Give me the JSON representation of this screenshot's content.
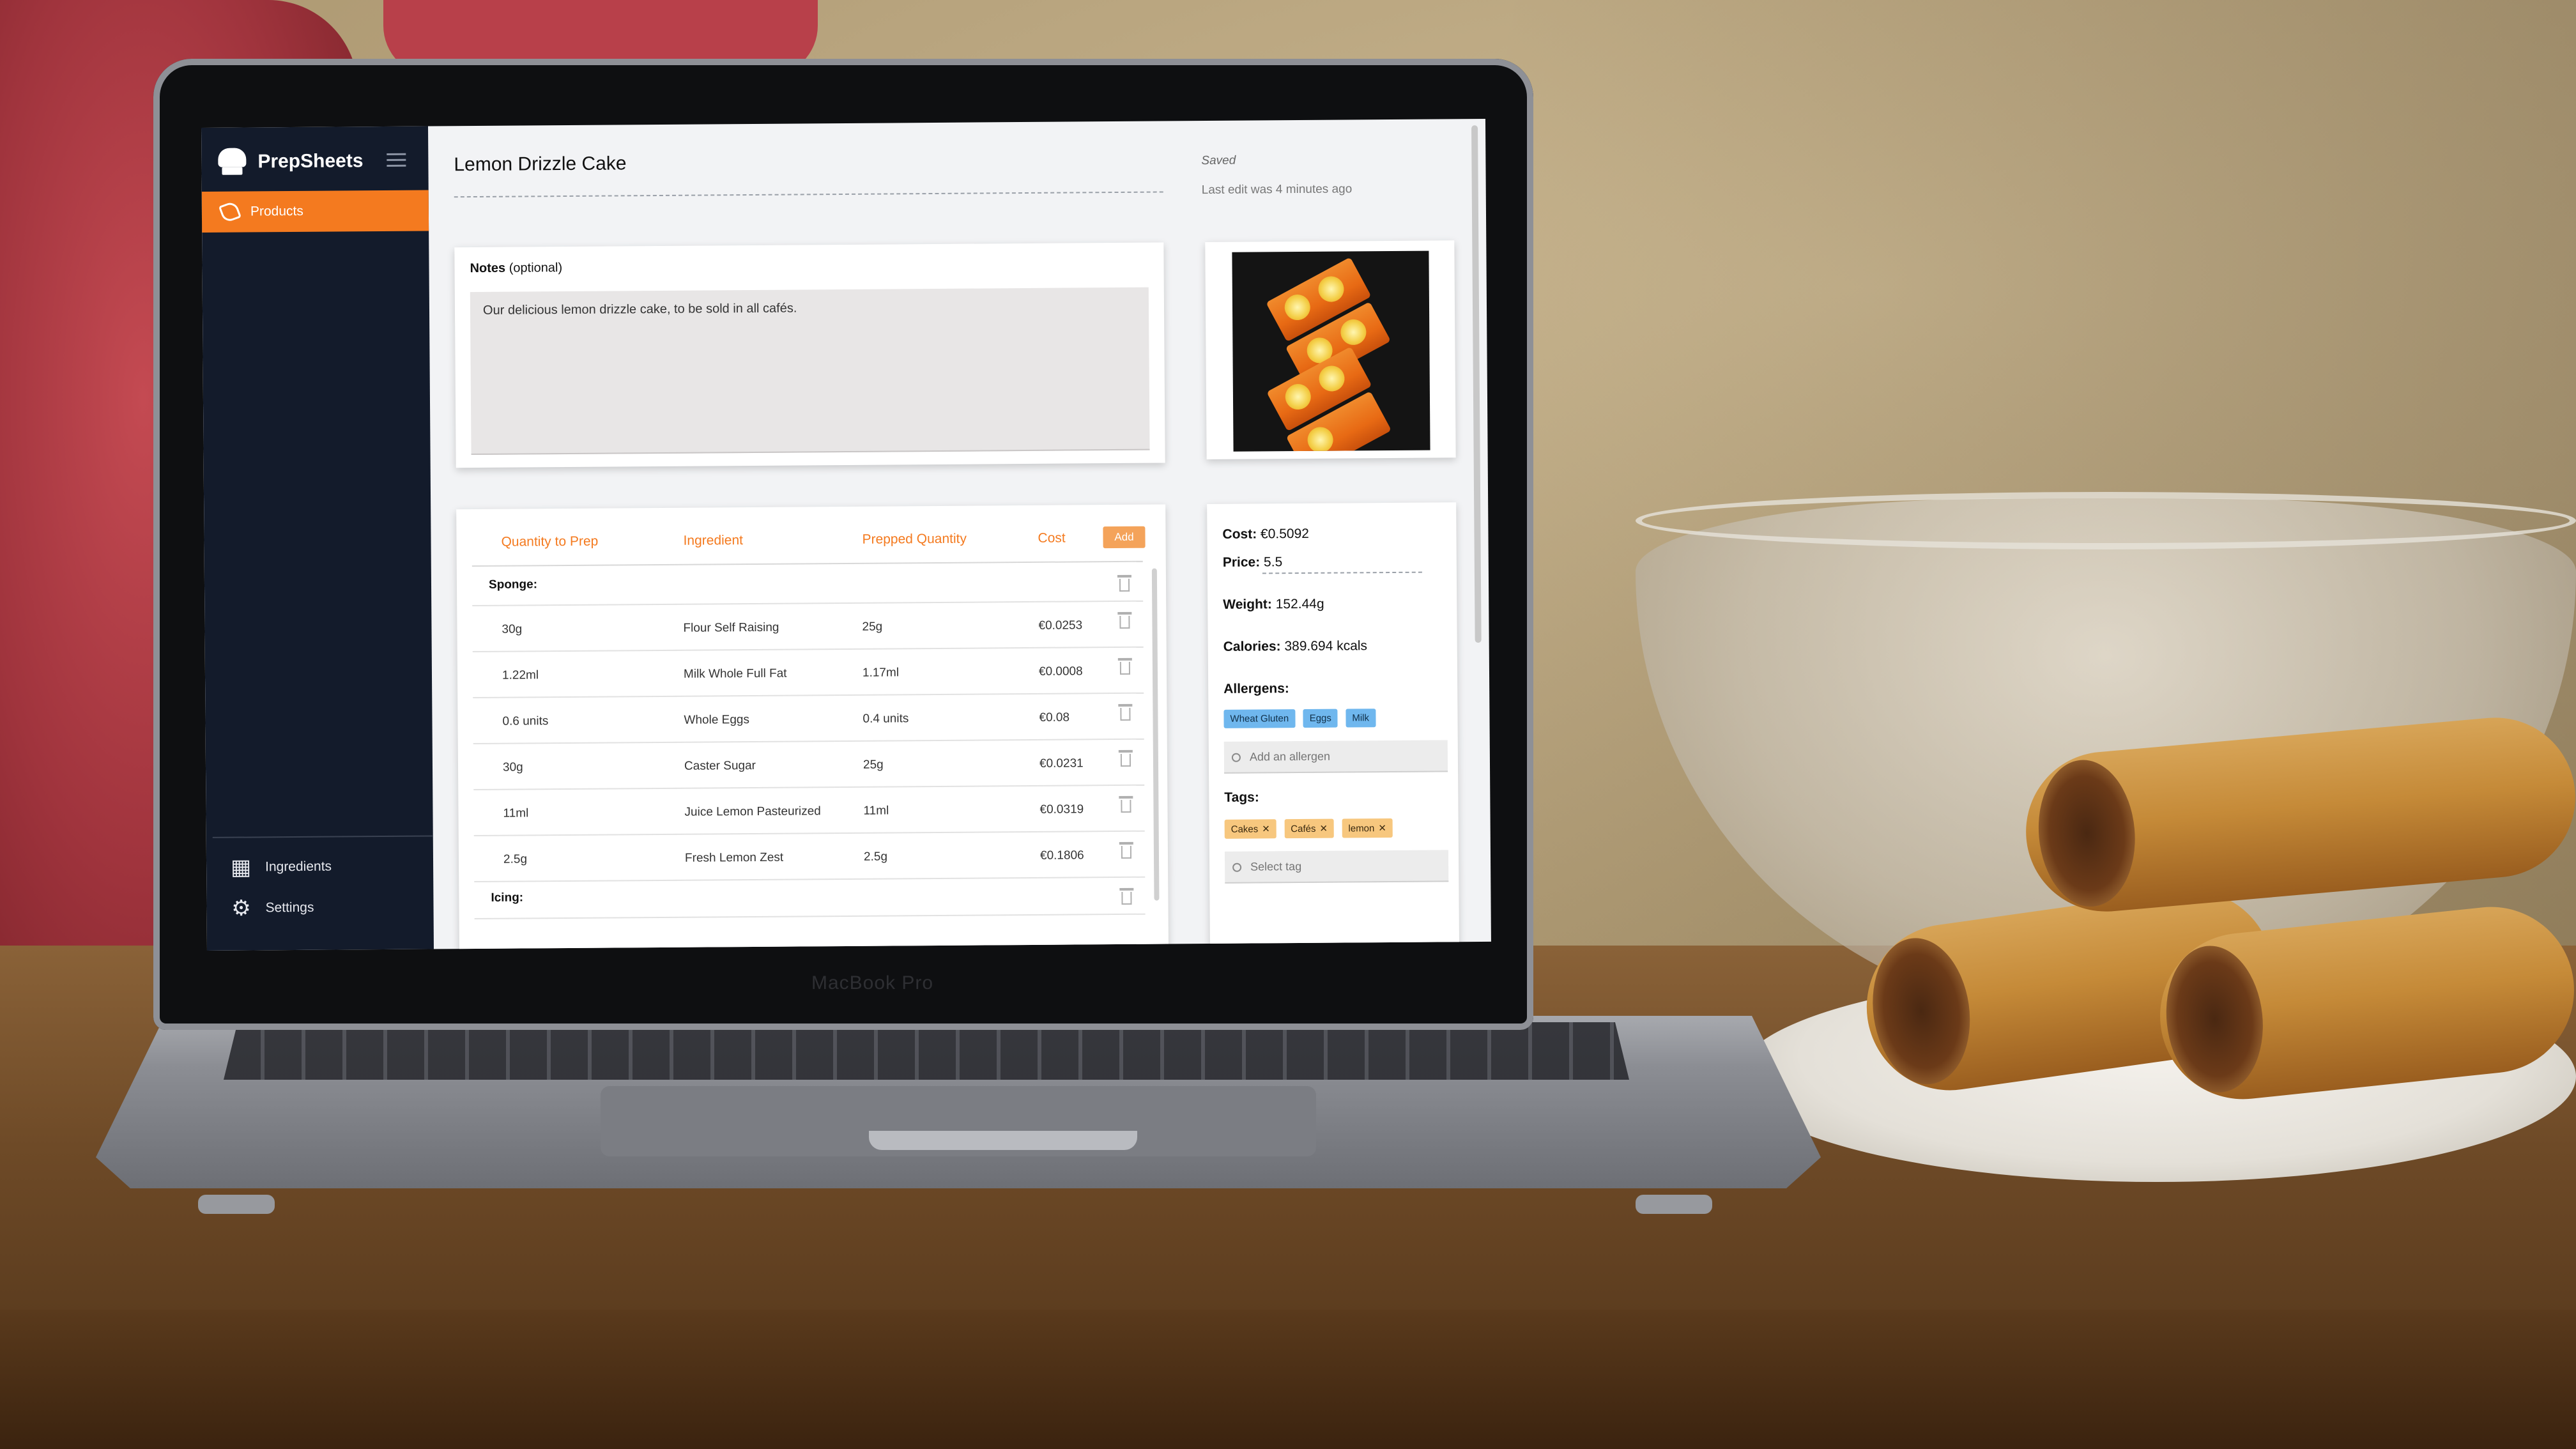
{
  "app": {
    "name": "PrepSheets",
    "nav": {
      "active": "Products",
      "bottom": [
        "Ingredients",
        "Settings"
      ]
    },
    "hamburger_icon": "menu-icon"
  },
  "product": {
    "title": "Lemon Drizzle Cake",
    "status": "Saved",
    "last_edit": "Last edit was 4 minutes ago",
    "notes_label": "Notes",
    "notes_optional": "(optional)",
    "notes_value": "Our delicious lemon drizzle cake, to be sold in all cafés."
  },
  "recipe": {
    "headers": [
      "Quantity to Prep",
      "Ingredient",
      "Prepped Quantity",
      "Cost"
    ],
    "add_label": "Add",
    "rows": [
      {
        "type": "section",
        "label": "Sponge:"
      },
      {
        "type": "item",
        "qty": "30g",
        "ingredient": "Flour Self Raising",
        "prepped": "25g",
        "cost": "€0.0253"
      },
      {
        "type": "item",
        "qty": "1.22ml",
        "ingredient": "Milk Whole Full Fat",
        "prepped": "1.17ml",
        "cost": "€0.0008"
      },
      {
        "type": "item",
        "qty": "0.6 units",
        "ingredient": "Whole Eggs",
        "prepped": "0.4 units",
        "cost": "€0.08"
      },
      {
        "type": "item",
        "qty": "30g",
        "ingredient": "Caster Sugar",
        "prepped": "25g",
        "cost": "€0.0231"
      },
      {
        "type": "item",
        "qty": "11ml",
        "ingredient": "Juice Lemon Pasteurized",
        "prepped": "11ml",
        "cost": "€0.0319"
      },
      {
        "type": "item",
        "qty": "2.5g",
        "ingredient": "Fresh Lemon Zest",
        "prepped": "2.5g",
        "cost": "€0.1806"
      },
      {
        "type": "section",
        "label": "Icing:"
      }
    ]
  },
  "summary": {
    "cost_label": "Cost:",
    "cost": "€0.5092",
    "price_label": "Price:",
    "price": "5.5",
    "weight_label": "Weight:",
    "weight": "152.44g",
    "calories_label": "Calories:",
    "calories": "389.694 kcals",
    "allergens_label": "Allergens:",
    "allergens": [
      "Wheat Gluten",
      "Eggs",
      "Milk"
    ],
    "allergen_placeholder": "Add an allergen",
    "tags_label": "Tags:",
    "tags": [
      "Cakes",
      "Cafés",
      "lemon"
    ],
    "tag_placeholder": "Select tag"
  },
  "device": {
    "brand": "MacBook Pro"
  },
  "colors": {
    "accent": "#f47a1f",
    "sidebar": "#131b2b",
    "allergen_chip": "#6fb7ee",
    "tag_chip": "#f7c77e"
  }
}
